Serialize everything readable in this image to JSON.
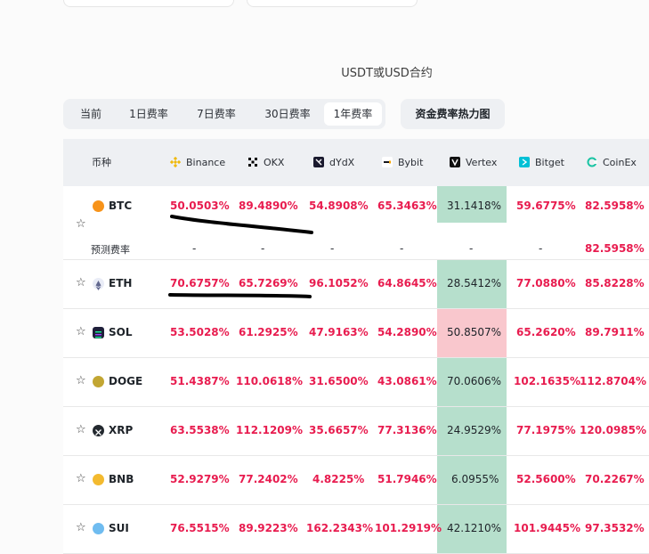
{
  "title": "USDT或USD合约",
  "tabs": [
    {
      "label": "当前",
      "active": false
    },
    {
      "label": "1日费率",
      "active": false
    },
    {
      "label": "7日费率",
      "active": false
    },
    {
      "label": "30日费率",
      "active": false
    },
    {
      "label": "1年费率",
      "active": true
    }
  ],
  "heatmap_button": "资金费率热力图",
  "columns": {
    "coin": "币种",
    "exchanges": [
      {
        "name": "Binance",
        "icon": "binance-icon",
        "color": "#f0b90b"
      },
      {
        "name": "OKX",
        "icon": "okx-icon",
        "color": "#000000"
      },
      {
        "name": "dYdX",
        "icon": "dydx-icon",
        "color": "#1a1a2e"
      },
      {
        "name": "Bybit",
        "icon": "bybit-icon",
        "color": "#17181e"
      },
      {
        "name": "Vertex",
        "icon": "vertex-icon",
        "color": "#111111"
      },
      {
        "name": "Bitget",
        "icon": "bitget-icon",
        "color": "#00c0d6"
      },
      {
        "name": "CoinEx",
        "icon": "coinex-icon",
        "color": "#19c4a3"
      }
    ]
  },
  "rows": [
    {
      "symbol": "BTC",
      "coin_color": "#f7931a",
      "rates": [
        "50.0503%",
        "89.4890%",
        "54.8908%",
        "65.3463%",
        "31.1418%",
        "59.6775%",
        "82.5958%"
      ],
      "vertex_bg": "#b6dfcc",
      "predicted": {
        "label": "预测费率",
        "values": [
          "-",
          "-",
          "-",
          "-",
          "-",
          "-",
          "82.5958%"
        ]
      }
    },
    {
      "symbol": "ETH",
      "coin_color": "#627eea",
      "rates": [
        "70.6757%",
        "65.7269%",
        "96.1052%",
        "64.8645%",
        "28.5412%",
        "77.0880%",
        "85.8228%"
      ],
      "vertex_bg": "#b6dfcc"
    },
    {
      "symbol": "SOL",
      "coin_color": "#1f1f3a",
      "rates": [
        "53.5028%",
        "61.2925%",
        "47.9163%",
        "54.2890%",
        "50.8507%",
        "65.2620%",
        "89.7911%"
      ],
      "vertex_bg": "#f9c7cd"
    },
    {
      "symbol": "DOGE",
      "coin_color": "#c2a633",
      "rates": [
        "51.4387%",
        "110.0618%",
        "31.6500%",
        "43.0861%",
        "70.0606%",
        "102.1635%",
        "112.8704%"
      ],
      "vertex_bg": "#b6dfcc"
    },
    {
      "symbol": "XRP",
      "coin_color": "#23292f",
      "rates": [
        "63.5538%",
        "112.1209%",
        "35.6657%",
        "77.3136%",
        "24.9529%",
        "77.1975%",
        "120.0985%"
      ],
      "vertex_bg": "#b6dfcc"
    },
    {
      "symbol": "BNB",
      "coin_color": "#f3ba2f",
      "rates": [
        "52.9279%",
        "77.2402%",
        "4.8225%",
        "51.7946%",
        "6.0955%",
        "52.5600%",
        "70.2267%"
      ],
      "vertex_bg": "#b6dfcc"
    },
    {
      "symbol": "SUI",
      "coin_color": "#6fbcf0",
      "rates": [
        "76.5515%",
        "89.9223%",
        "162.2343%",
        "101.2919%",
        "42.1210%",
        "101.9445%",
        "97.3532%"
      ],
      "vertex_bg": "#b6dfcc"
    }
  ],
  "colors": {
    "rate_red": "#e81c4f",
    "accent_gray": "#eef0f3"
  }
}
